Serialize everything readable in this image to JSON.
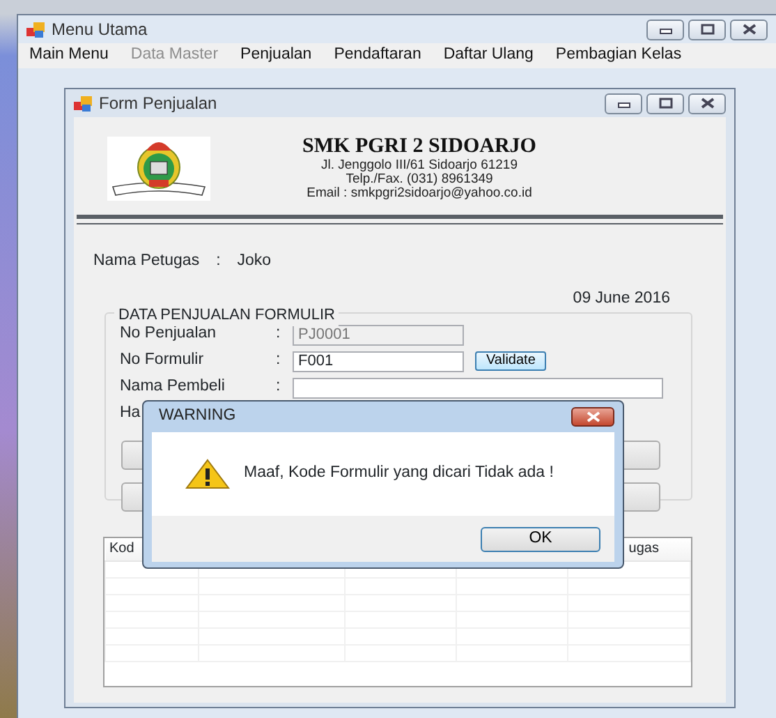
{
  "main_window": {
    "title": "Menu Utama",
    "menu": [
      {
        "label": "Main Menu",
        "disabled": false
      },
      {
        "label": "Data Master",
        "disabled": true
      },
      {
        "label": "Penjualan",
        "disabled": false
      },
      {
        "label": "Pendaftaran",
        "disabled": false
      },
      {
        "label": "Daftar Ulang",
        "disabled": false
      },
      {
        "label": "Pembagian Kelas",
        "disabled": false
      }
    ]
  },
  "form": {
    "title": "Form Penjualan",
    "school": {
      "name": "SMK PGRI 2 SIDOARJO",
      "address": "Jl. Jenggolo III/61 Sidoarjo 61219",
      "phone": "Telp./Fax. (031) 8961349",
      "email": "Email : smkpgri2sidoarjo@yahoo.co.id"
    },
    "officer": {
      "label": "Nama Petugas",
      "separator": ":",
      "value": "Joko"
    },
    "date": "09 June 2016",
    "group": {
      "title": "DATA PENJUALAN FORMULIR",
      "rows": [
        {
          "kind": "field",
          "label": "No Penjualan",
          "separator": ":",
          "value": "PJ0001",
          "disabled": true
        },
        {
          "kind": "field",
          "label": "No Formulir",
          "separator": ":",
          "value": "F001",
          "disabled": false,
          "button": "Validate"
        },
        {
          "kind": "wide",
          "label": "Nama Pembeli",
          "separator": ":",
          "disabled": false
        },
        {
          "kind": "label",
          "label": "Ha"
        }
      ]
    },
    "table": {
      "columns": [
        {
          "label": "Kod"
        },
        {},
        {},
        {},
        {
          "label": "ugas"
        }
      ]
    }
  },
  "dialog": {
    "title": "WARNING",
    "message": "Maaf, Kode Formulir yang dicari Tidak ada !",
    "button": "OK"
  }
}
